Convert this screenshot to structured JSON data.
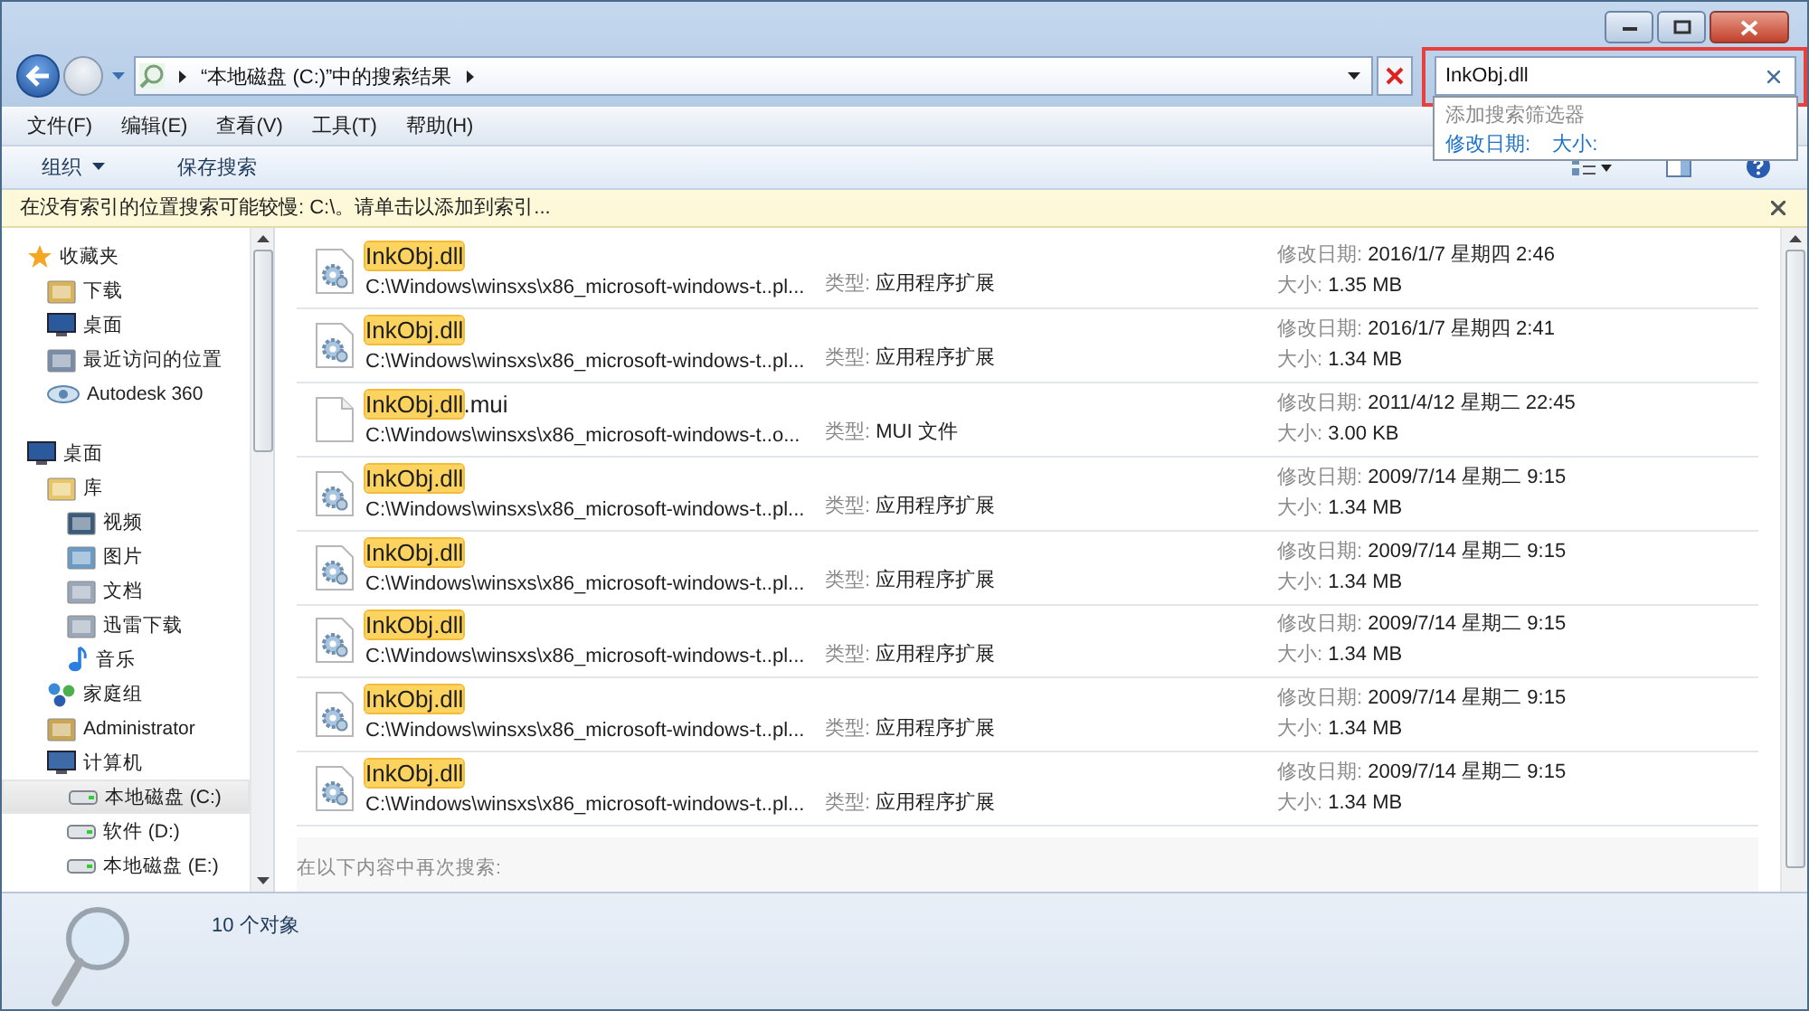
{
  "address": {
    "crumbs": [
      "“本地磁盘 (C:)”中的搜索结果"
    ]
  },
  "search": {
    "value": "InkObj.dll",
    "highlighted": true,
    "dropdown": {
      "title": "添加搜索筛选器",
      "filters": [
        "修改日期:",
        "大小:"
      ]
    }
  },
  "menu": [
    "文件(F)",
    "编辑(E)",
    "查看(V)",
    "工具(T)",
    "帮助(H)"
  ],
  "toolbar": [
    {
      "label": "组织",
      "dropdown": true
    },
    {
      "label": "保存搜索",
      "dropdown": false
    }
  ],
  "infobar": {
    "text": "在没有索引的位置搜索可能较慢: C:\\。请单击以添加到索引..."
  },
  "sidebar": {
    "items": [
      {
        "label": "收藏夹",
        "kind": "star",
        "selected": false,
        "children": [
          {
            "label": "下载",
            "kind": "download",
            "selected": false
          },
          {
            "label": "桌面",
            "kind": "desktop",
            "selected": false
          },
          {
            "label": "最近访问的位置",
            "kind": "recent",
            "selected": false
          },
          {
            "label": "Autodesk 360",
            "kind": "cloud",
            "selected": false
          }
        ]
      },
      {
        "label": "桌面",
        "kind": "desktop",
        "selected": false,
        "children": [
          {
            "label": "库",
            "kind": "library",
            "selected": false,
            "children": [
              {
                "label": "视频",
                "kind": "video",
                "selected": false
              },
              {
                "label": "图片",
                "kind": "image",
                "selected": false
              },
              {
                "label": "文档",
                "kind": "doc",
                "selected": false
              },
              {
                "label": "迅雷下载",
                "kind": "doc",
                "selected": false
              },
              {
                "label": "音乐",
                "kind": "music",
                "selected": false
              }
            ]
          },
          {
            "label": "家庭组",
            "kind": "homegroup",
            "selected": false
          },
          {
            "label": "Administrator",
            "kind": "user",
            "selected": false
          },
          {
            "label": "计算机",
            "kind": "computer",
            "selected": false,
            "children": [
              {
                "label": "本地磁盘 (C:)",
                "kind": "drive",
                "selected": true
              },
              {
                "label": "软件 (D:)",
                "kind": "drive",
                "selected": false
              },
              {
                "label": "本地磁盘 (E:)",
                "kind": "drive",
                "selected": false
              }
            ]
          }
        ]
      }
    ]
  },
  "results": [
    {
      "kind": "dll",
      "match": "InkObj.dll",
      "path": "C:\\Windows\\winsxs\\x86_microsoft-windows-t..pl...",
      "type_label": "类型:",
      "type": "应用程序扩展",
      "date_label": "修改日期:",
      "date": "2016/1/7 星期四 2:46",
      "size_label": "大小:",
      "size": "1.35 MB"
    },
    {
      "kind": "dll",
      "match": "InkObj.dll",
      "path": "C:\\Windows\\winsxs\\x86_microsoft-windows-t..pl...",
      "type_label": "类型:",
      "type": "应用程序扩展",
      "date_label": "修改日期:",
      "date": "2016/1/7 星期四 2:41",
      "size_label": "大小:",
      "size": "1.34 MB"
    },
    {
      "kind": "blank",
      "match": "InkObj.dll",
      "rest": ".mui",
      "path": "C:\\Windows\\winsxs\\x86_microsoft-windows-t..o...",
      "type_label": "类型:",
      "type": "MUI 文件",
      "date_label": "修改日期:",
      "date": "2011/4/12 星期二 22:45",
      "size_label": "大小:",
      "size": "3.00 KB"
    },
    {
      "kind": "dll",
      "match": "InkObj.dll",
      "path": "C:\\Windows\\winsxs\\x86_microsoft-windows-t..pl...",
      "type_label": "类型:",
      "type": "应用程序扩展",
      "date_label": "修改日期:",
      "date": "2009/7/14 星期二 9:15",
      "size_label": "大小:",
      "size": "1.34 MB"
    },
    {
      "kind": "dll",
      "match": "InkObj.dll",
      "path": "C:\\Windows\\winsxs\\x86_microsoft-windows-t..pl...",
      "type_label": "类型:",
      "type": "应用程序扩展",
      "date_label": "修改日期:",
      "date": "2009/7/14 星期二 9:15",
      "size_label": "大小:",
      "size": "1.34 MB"
    },
    {
      "kind": "dll",
      "match": "InkObj.dll",
      "path": "C:\\Windows\\winsxs\\x86_microsoft-windows-t..pl...",
      "type_label": "类型:",
      "type": "应用程序扩展",
      "date_label": "修改日期:",
      "date": "2009/7/14 星期二 9:15",
      "size_label": "大小:",
      "size": "1.34 MB"
    },
    {
      "kind": "dll",
      "match": "InkObj.dll",
      "path": "C:\\Windows\\winsxs\\x86_microsoft-windows-t..pl...",
      "type_label": "类型:",
      "type": "应用程序扩展",
      "date_label": "修改日期:",
      "date": "2009/7/14 星期二 9:15",
      "size_label": "大小:",
      "size": "1.34 MB"
    },
    {
      "kind": "dll",
      "match": "InkObj.dll",
      "path": "C:\\Windows\\winsxs\\x86_microsoft-windows-t..pl...",
      "type_label": "类型:",
      "type": "应用程序扩展",
      "date_label": "修改日期:",
      "date": "2009/7/14 星期二 9:15",
      "size_label": "大小:",
      "size": "1.34 MB"
    }
  ],
  "search_again": "在以下内容中再次搜索:",
  "status_bar": {
    "count": "10 个对象"
  }
}
